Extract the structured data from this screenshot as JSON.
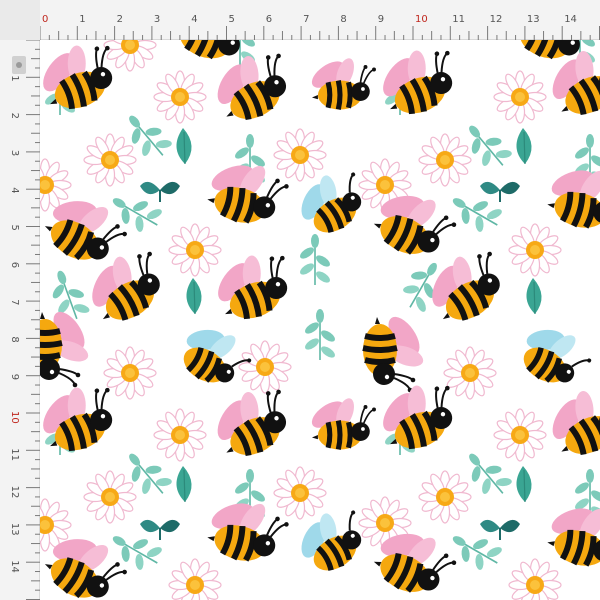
{
  "pattern": {
    "motifs": [
      "bee-icon",
      "daisy-icon",
      "leaf-sprig-icon"
    ],
    "colors": {
      "background": "#ffffff",
      "bee_body": "#f5a80f",
      "bee_stripe": "#111111",
      "wing_pink": "#f2a6c7",
      "wing_blue": "#9fd9ea",
      "daisy_petal": "#ffffff",
      "daisy_outline": "#f0b8cf",
      "daisy_center": "#f7a916",
      "leaf_light": "#7ccab9",
      "leaf_dark": "#1e6b68"
    }
  },
  "ruler": {
    "top_labels": [
      "0",
      "1",
      "2",
      "3",
      "4",
      "5",
      "6",
      "7",
      "8",
      "9",
      "10",
      "11",
      "12",
      "13",
      "14"
    ],
    "left_labels": [
      "1",
      "2",
      "3",
      "4",
      "5",
      "6",
      "7",
      "8",
      "9",
      "10",
      "11",
      "12",
      "13",
      "14"
    ],
    "accent_labels": [
      "0",
      "10"
    ],
    "colors": {
      "ruler_bg": "#f3f3f3",
      "tick": "#7a7a7a",
      "label": "#555555",
      "accent": "#c0271e"
    }
  }
}
